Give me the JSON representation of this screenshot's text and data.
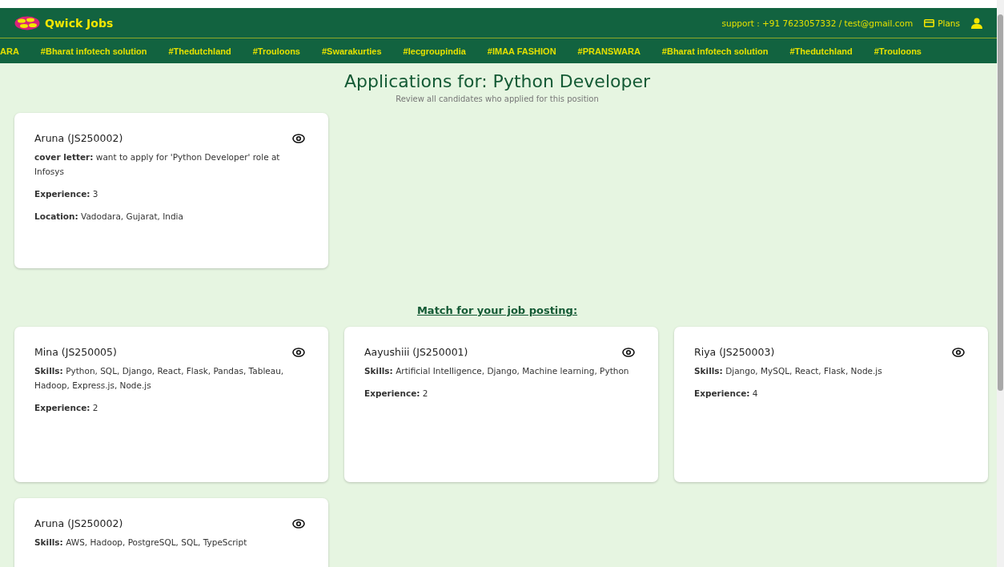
{
  "header": {
    "brand": "Qwick Jobs",
    "support": "support : +91 7623057332 / test@gmail.com",
    "plans": "Plans"
  },
  "ticker": [
    "ARA",
    "#Bharat infotech solution",
    "#Thedutchland",
    "#Trouloons",
    "#Swarakurties",
    "#Iecgroupindia",
    "#IMAA FASHION",
    "#PRANSWARA",
    "#Bharat infotech solution",
    "#Thedutchland",
    "#Trouloons"
  ],
  "page": {
    "title": "Applications for: Python Developer",
    "subtitle": "Review all candidates who applied for this position"
  },
  "applications": [
    {
      "name": "Aruna (JS250002)",
      "fields": [
        "**cover letter:** want to apply for 'Python Developer' role at Infosys",
        "**Experience:** 3",
        "**Location:** Vadodara, Gujarat, India"
      ]
    }
  ],
  "matches_heading": "Match for your job posting:",
  "matches": [
    {
      "name": "Mina (JS250005)",
      "fields": [
        "**Skills:** Python, SQL, Django, React, Flask, Pandas, Tableau, Hadoop, Express.js, Node.js",
        "**Experience:** 2"
      ]
    },
    {
      "name": "Aayushiii (JS250001)",
      "fields": [
        "**Skills:** Artificial Intelligence, Django, Machine learning, Python",
        "**Experience:** 2"
      ]
    },
    {
      "name": "Riya (JS250003)",
      "fields": [
        "**Skills:** Django, MySQL, React, Flask, Node.js",
        "**Experience:** 4"
      ]
    },
    {
      "name": "Aruna (JS250002)",
      "fields": [
        "**Skills:** AWS, Hadoop, PostgreSQL, SQL, TypeScript"
      ]
    }
  ]
}
